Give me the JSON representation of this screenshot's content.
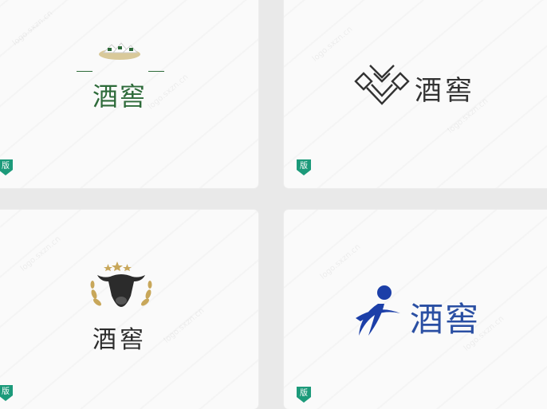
{
  "cards": [
    {
      "logo_text": "酒窖",
      "badge": "版",
      "color": "#2e6b3a"
    },
    {
      "logo_text": "酒窖",
      "badge": "版",
      "color": "#333333"
    },
    {
      "logo_text": "酒窖",
      "badge": "版",
      "color": "#2b2b2b"
    },
    {
      "logo_text": "酒窖",
      "badge": "版",
      "color": "#2a4fa3"
    }
  ],
  "watermark": "logo.sxzn.cn"
}
